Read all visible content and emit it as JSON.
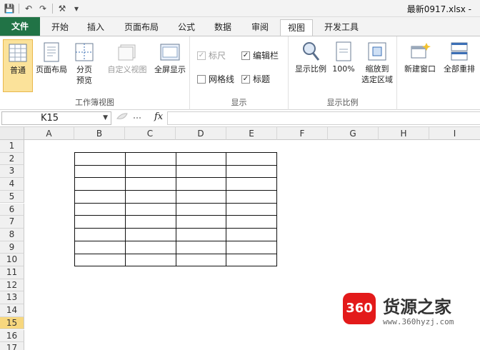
{
  "window": {
    "title": "最新0917.xlsx - "
  },
  "quick_access": [
    {
      "icon": "save-icon",
      "glyph": "💾"
    },
    {
      "icon": "undo-icon",
      "glyph": "↶"
    },
    {
      "icon": "redo-icon",
      "glyph": "↷"
    },
    {
      "icon": "tools-icon",
      "glyph": "⚒"
    },
    {
      "icon": "customize-icon",
      "glyph": "▾"
    }
  ],
  "tabs": {
    "file": "文件",
    "home": "开始",
    "insert": "插入",
    "page_layout": "页面布局",
    "formulas": "公式",
    "data": "数据",
    "review": "审阅",
    "view": "视图",
    "developer": "开发工具"
  },
  "active_tab": "视图",
  "ribbon": {
    "workbook_views": {
      "label": "工作簿视图",
      "normal": "普通",
      "page_layout": "页面布局",
      "page_break_1": "分页",
      "page_break_2": "预览",
      "custom_views": "自定义视图",
      "full_screen": "全屏显示"
    },
    "show": {
      "label": "显示",
      "ruler": "标尺",
      "ruler_checked": true,
      "formula_bar": "编辑栏",
      "formula_bar_checked": true,
      "gridlines": "网格线",
      "gridlines_checked": false,
      "headings": "标题",
      "headings_checked": true
    },
    "zoom": {
      "label": "显示比例",
      "zoom": "显示比例",
      "hundred": "100%",
      "zoom_sel_1": "缩放到",
      "zoom_sel_2": "选定区域"
    },
    "window": {
      "new_window": "新建窗口",
      "arrange_all": "全部重排"
    }
  },
  "formula_bar": {
    "name_box": "K15",
    "fx": "fx",
    "content": ""
  },
  "columns": [
    "A",
    "B",
    "C",
    "D",
    "E",
    "F",
    "G",
    "H",
    "I"
  ],
  "rows": [
    "1",
    "2",
    "3",
    "4",
    "5",
    "6",
    "7",
    "8",
    "9",
    "10",
    "11",
    "12",
    "13",
    "14",
    "15",
    "16",
    "17"
  ],
  "selected_row": "15",
  "watermark": {
    "logo_text": "360",
    "brand": "货源之家",
    "url": "www.360hyzj.com"
  }
}
